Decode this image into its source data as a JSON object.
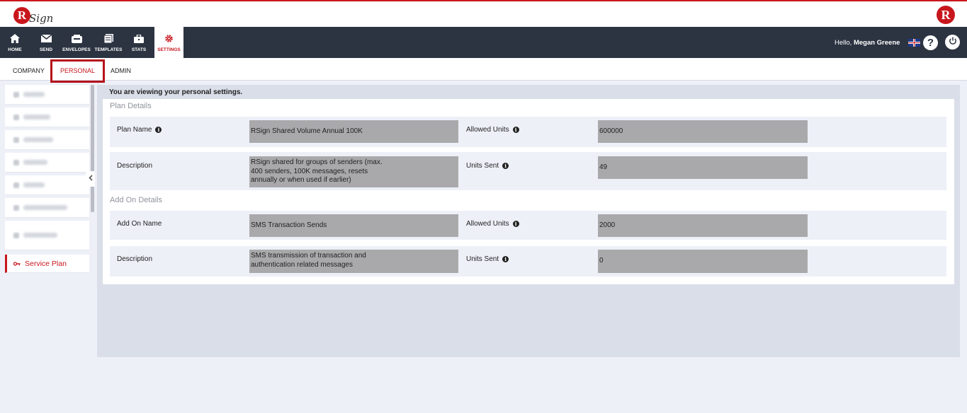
{
  "brand": {
    "logo_letter": "R",
    "logo_word": "Sign",
    "right_logo_letter": "R",
    "accent": "#c8161d",
    "nav_bg": "#2c3341"
  },
  "nav": {
    "items": [
      {
        "label": "HOME",
        "icon": "home-icon"
      },
      {
        "label": "SEND",
        "icon": "envelope-icon"
      },
      {
        "label": "ENVELOPES",
        "icon": "inbox-icon"
      },
      {
        "label": "TEMPLATES",
        "icon": "document-icon"
      },
      {
        "label": "STATS",
        "icon": "briefcase-icon"
      },
      {
        "label": "SETTINGS",
        "icon": "gear-icon"
      }
    ],
    "greeting_prefix": "Hello, ",
    "user_name": "Megan Greene",
    "help_label": "?"
  },
  "subtabs": {
    "company": "COMPANY",
    "personal": "PERSONAL",
    "admin": "ADMIN"
  },
  "sidebar": {
    "active_label": "Service Plan"
  },
  "main": {
    "viewing_text": "You are viewing your personal settings.",
    "plan_details": {
      "title": "Plan Details",
      "plan_name_label": "Plan Name",
      "plan_name_value": "RSign Shared Volume Annual 100K",
      "allowed_units_label": "Allowed Units",
      "allowed_units_value": "600000",
      "description_label": "Description",
      "description_line1": "RSign shared for groups of senders (max.",
      "description_line2": "400 senders, 100K messages, resets",
      "description_line3": "annually or when used if earlier)",
      "units_sent_label": "Units Sent",
      "units_sent_value": "49"
    },
    "addon_details": {
      "title": "Add On Details",
      "addon_name_label": "Add On Name",
      "addon_name_value": "SMS Transaction Sends",
      "allowed_units_label": "Allowed Units",
      "allowed_units_value": "2000",
      "description_label": "Description",
      "description_line1": "SMS transmission of transaction and",
      "description_line2": "authentication related messages",
      "units_sent_label": "Units Sent",
      "units_sent_value": "0"
    }
  }
}
